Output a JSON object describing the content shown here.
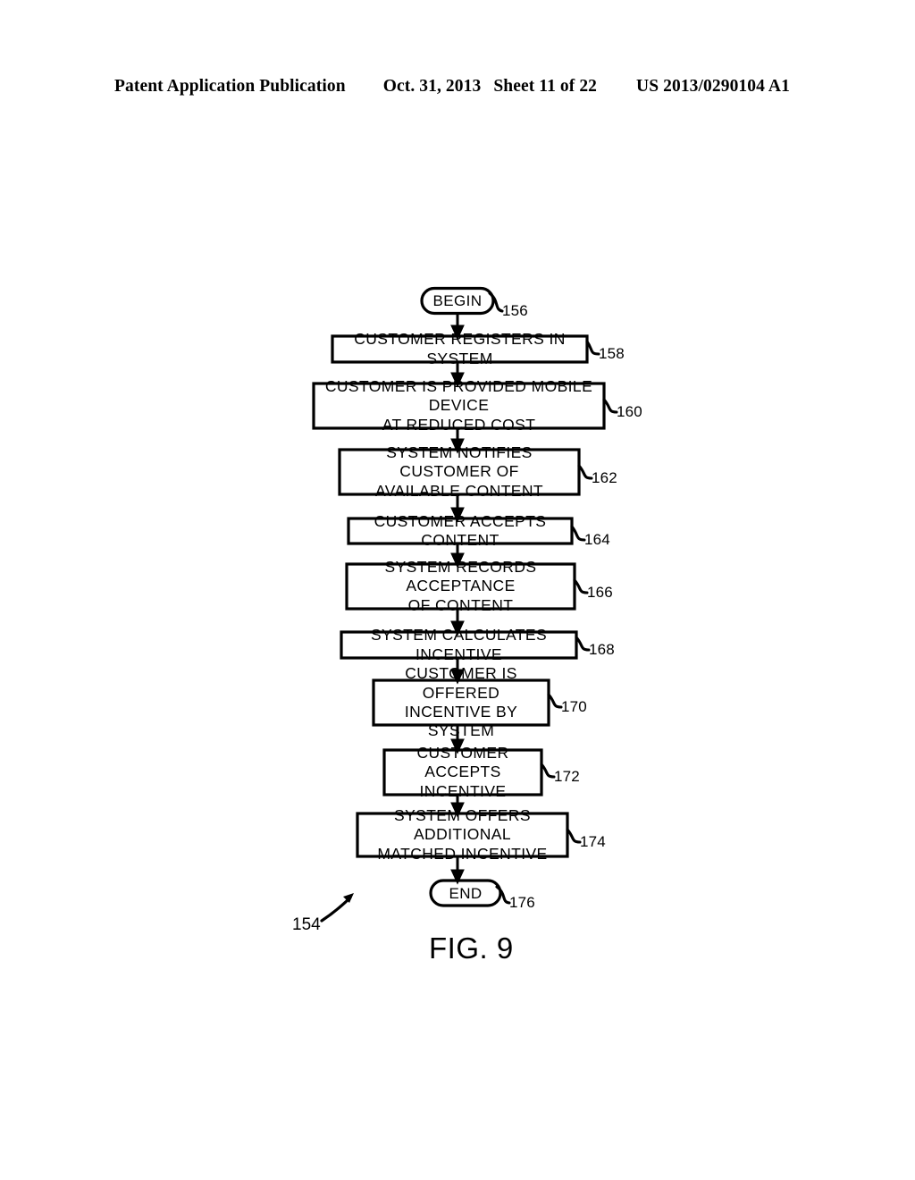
{
  "header": {
    "publication": "Patent Application Publication",
    "date": "Oct. 31, 2013",
    "sheet": "Sheet 11 of 22",
    "patent_number": "US 2013/0290104 A1"
  },
  "figure": {
    "label": "FIG. 9",
    "assembly_tag": "154",
    "nodes": [
      {
        "id": "156",
        "type": "terminal",
        "text": "BEGIN",
        "ref": "156"
      },
      {
        "id": "158",
        "type": "process",
        "text": "CUSTOMER  REGISTERS  IN  SYSTEM",
        "ref": "158"
      },
      {
        "id": "160",
        "type": "process",
        "text": "CUSTOMER  IS  PROVIDED  MOBILE  DEVICE\nAT  REDUCED  COST",
        "ref": "160"
      },
      {
        "id": "162",
        "type": "process",
        "text": "SYSTEM  NOTIFIES CUSTOMER  OF\nAVAILABLE  CONTENT",
        "ref": "162"
      },
      {
        "id": "164",
        "type": "process",
        "text": "CUSTOMER  ACCEPTS  CONTENT",
        "ref": "164"
      },
      {
        "id": "166",
        "type": "process",
        "text": "SYSTEM   RECORDS ACCEPTANCE\nOF CONTENT",
        "ref": "166"
      },
      {
        "id": "168",
        "type": "process",
        "text": "SYSTEM  CALCULATES  INCENTIVE",
        "ref": "168"
      },
      {
        "id": "170",
        "type": "process",
        "text": "CUSTOMER  IS  OFFERED\nINCENTIVE  BY  SYSTEM",
        "ref": "170"
      },
      {
        "id": "172",
        "type": "process",
        "text": "CUSTOMER  ACCEPTS\nINCENTIVE",
        "ref": "172"
      },
      {
        "id": "174",
        "type": "process",
        "text": "SYSTEM  OFFERS ADDITIONAL\nMATCHED  INCENTIVE",
        "ref": "174"
      },
      {
        "id": "176",
        "type": "terminal",
        "text": "END",
        "ref": "176"
      }
    ]
  },
  "colors": {
    "ink": "#000000",
    "paper": "#ffffff"
  }
}
